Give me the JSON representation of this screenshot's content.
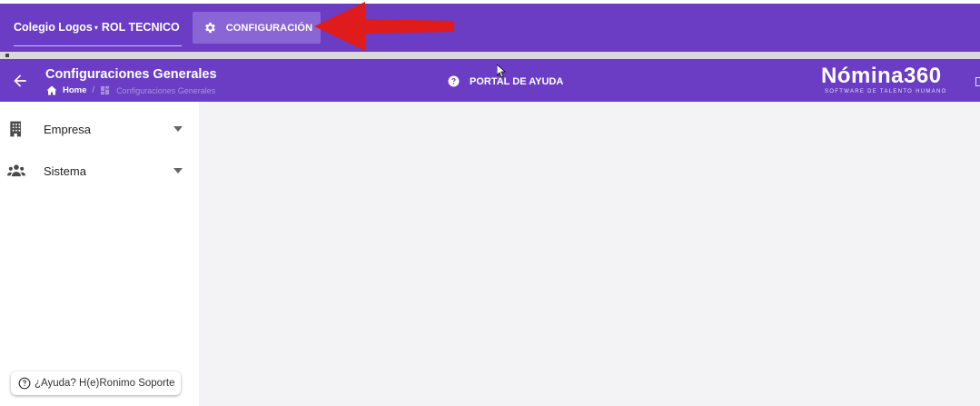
{
  "topbar": {
    "company_name": "Colegio Logos",
    "caret_glyph": "▾",
    "role": "ROL TECNICO",
    "config_button": "CONFIGURACIÓN",
    "config_icon": "gear-icon",
    "background": "#6a3dc4"
  },
  "header": {
    "back_icon": "arrow-left-icon",
    "title": "Configuraciones Generales",
    "breadcrumb": {
      "home": "Home",
      "separator": "/",
      "current": "Configuraciones Generales"
    },
    "help": "PORTAL DE AYUDA",
    "help_icon": "question-circle-icon",
    "logo_word": "Nómina360",
    "logo_tagline": "SOFTWARE DE TALENTO HUMANO"
  },
  "sidebar": {
    "items": [
      {
        "label": "Empresa",
        "icon": "building-icon"
      },
      {
        "label": "Sistema",
        "icon": "users-icon"
      }
    ],
    "support": "¿Ayuda? H(e)Ronimo Soporte"
  },
  "annotation": {
    "arrow_color": "#e01b1b"
  }
}
